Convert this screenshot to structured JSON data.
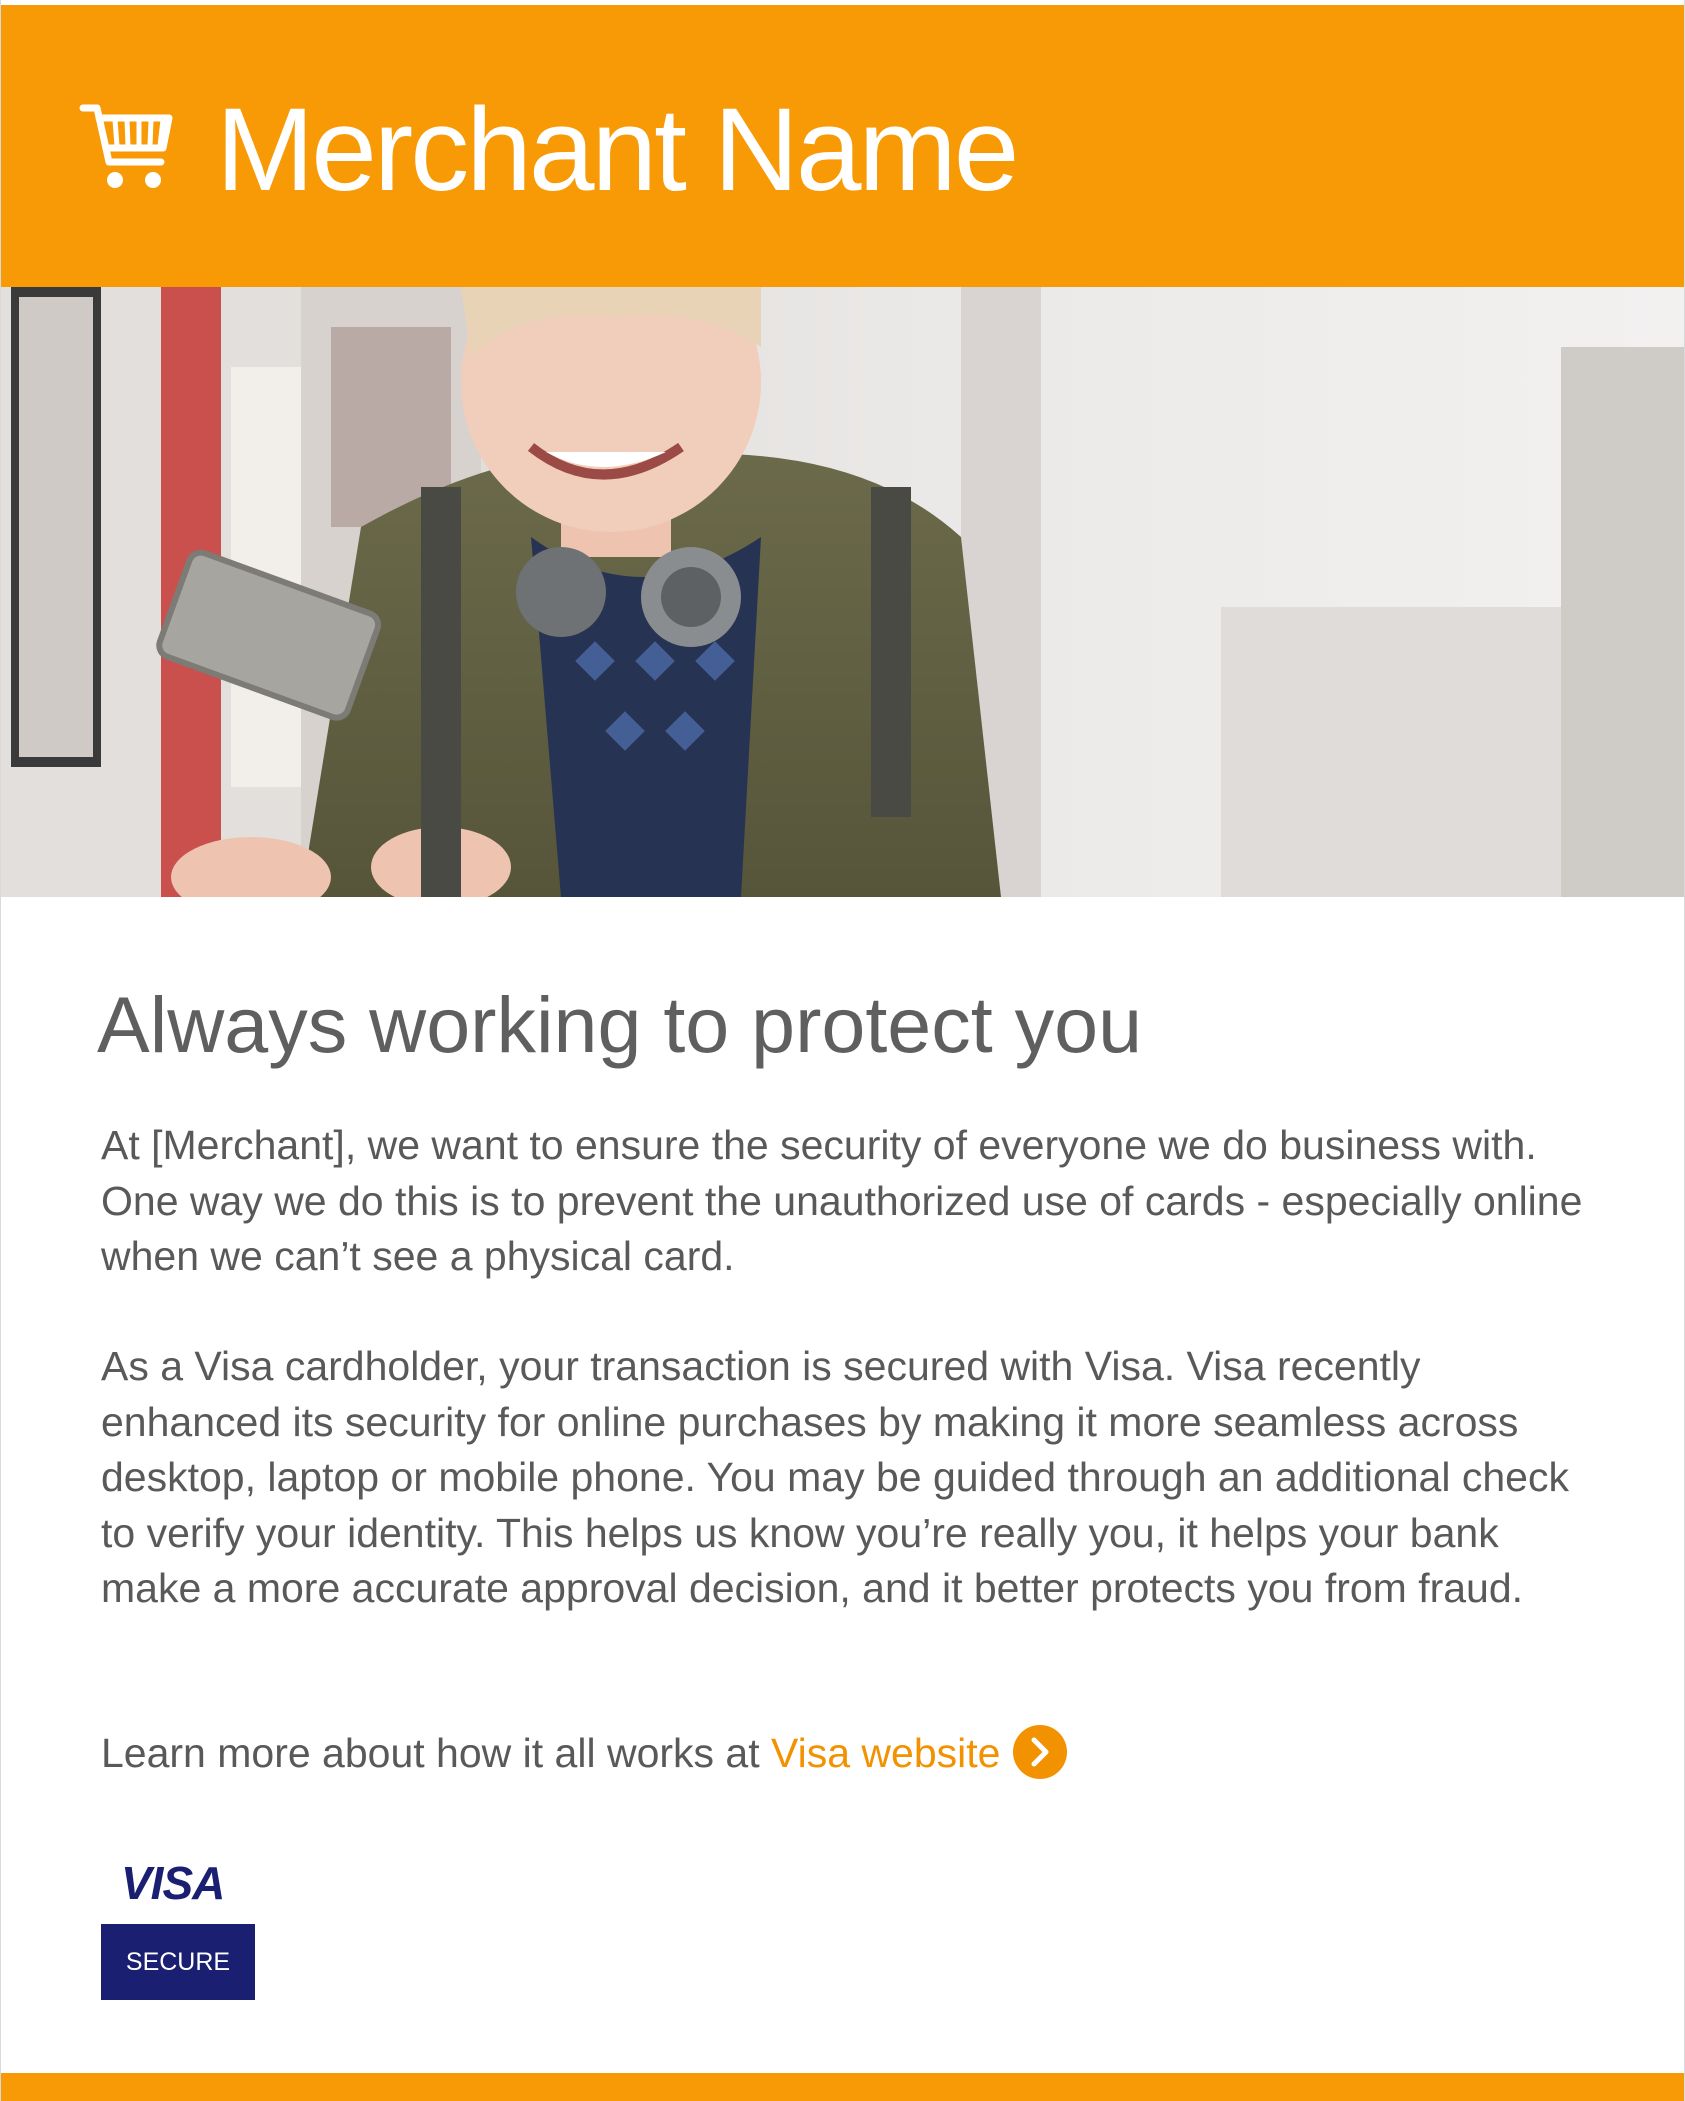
{
  "header": {
    "merchant_name": "Merchant Name",
    "icon": "shopping-cart-icon",
    "background_color": "#f89a06"
  },
  "hero": {
    "description_icon": "hero-photo"
  },
  "content": {
    "headline": "Always working to protect you",
    "paragraph1": "At [Merchant], we want to ensure the security of everyone we do business with. One way we do this is to prevent the unauthorized use of cards - especially online when we can’t see a physical card.",
    "paragraph2": "As a Visa cardholder, your transaction is secured with Visa. Visa recently enhanced its security for online purchases by making it more seamless across desktop, laptop or mobile phone. You may be guided through an additional check to verify your identity. This helps us know you’re really you, it helps your bank make a more accurate approval decision, and it better protects you from fraud.",
    "learn_more_prefix": "Learn more about how it all works at ",
    "learn_more_link": "Visa website",
    "link_color": "#f39200",
    "arrow_icon": "chevron-right-circle-icon"
  },
  "badge": {
    "brand": "VISA",
    "label": "SECURE",
    "brand_color": "#1a1f71"
  }
}
